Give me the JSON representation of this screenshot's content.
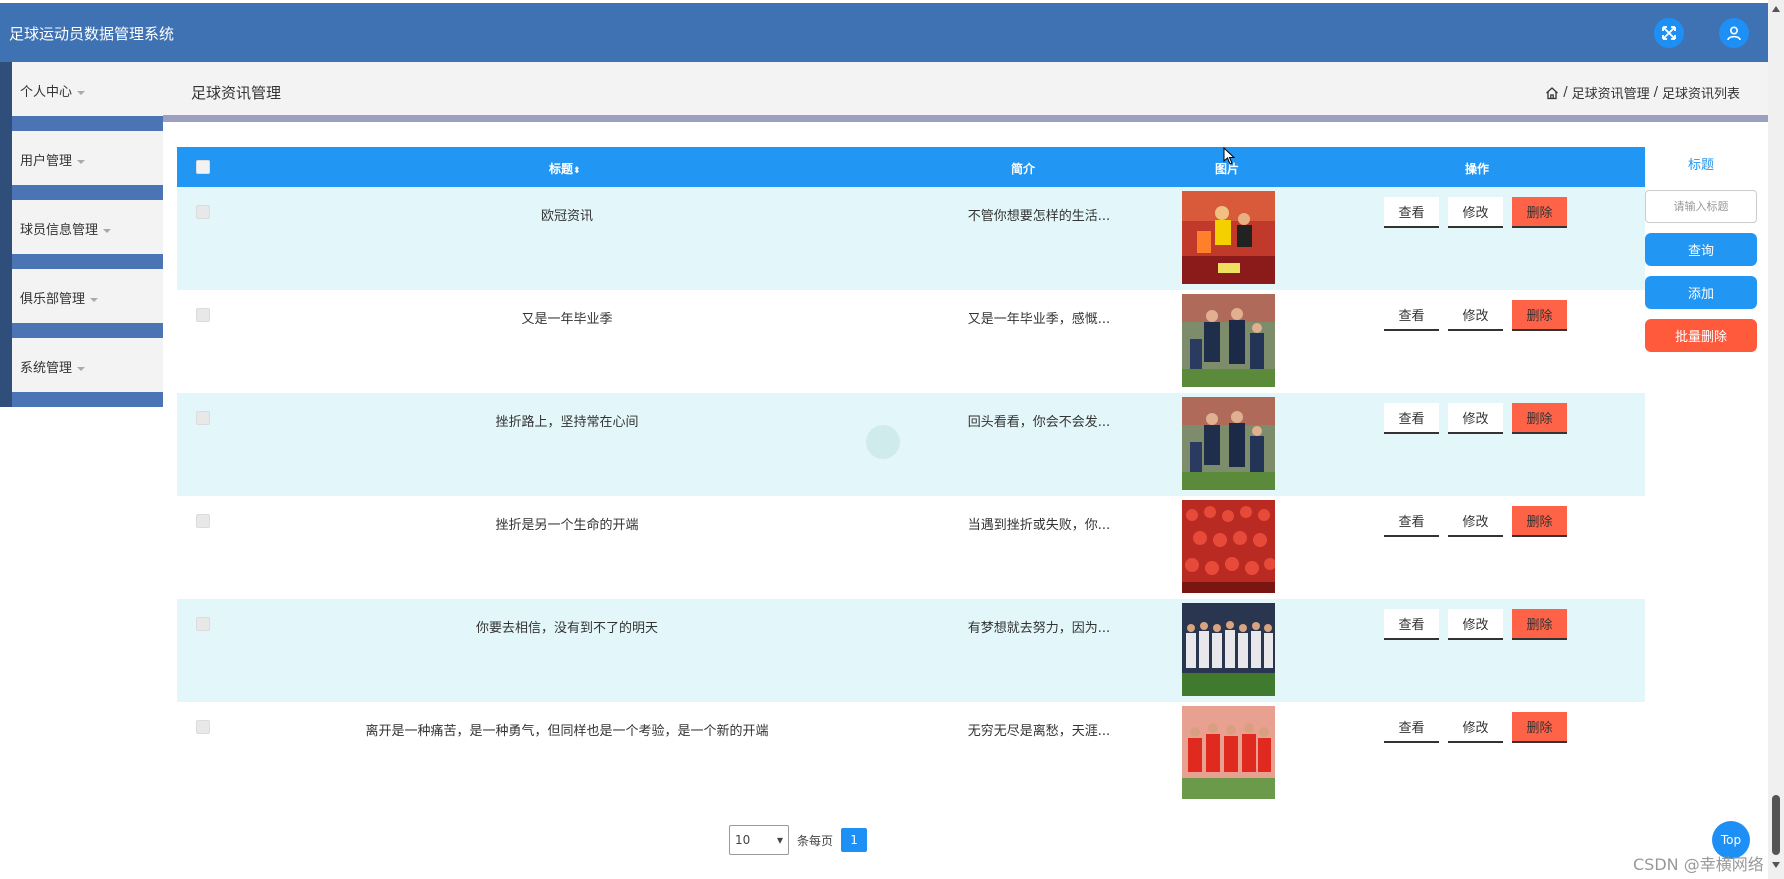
{
  "app": {
    "title": "足球运动员数据管理系统"
  },
  "topbar": {
    "fullscreen_icon": "fullscreen-icon",
    "user_icon": "user-icon"
  },
  "sidebar": {
    "items": [
      {
        "label": "个人中心"
      },
      {
        "label": "用户管理"
      },
      {
        "label": "球员信息管理"
      },
      {
        "label": "俱乐部管理"
      },
      {
        "label": "系统管理"
      }
    ]
  },
  "header": {
    "page_title": "足球资讯管理",
    "breadcrumb": [
      "足球资讯管理",
      "足球资讯列表"
    ],
    "breadcrumb_sep": "/"
  },
  "table": {
    "columns": {
      "title": "标题",
      "summary": "简介",
      "image": "图片",
      "actions": "操作"
    },
    "rows": [
      {
        "title": "欧冠资讯",
        "summary": "不管你想要怎样的生活...",
        "image": "photo-players-match"
      },
      {
        "title": "又是一年毕业季",
        "summary": "又是一年毕业季，感慨...",
        "image": "photo-players-celebrate"
      },
      {
        "title": "挫折路上，坚持常在心间",
        "summary": "回头看看，你会不会发...",
        "image": "photo-players-celebrate"
      },
      {
        "title": "挫折是另一个生命的开端",
        "summary": "当遇到挫折或失败，你...",
        "image": "photo-crowd-red"
      },
      {
        "title": "你要去相信，没有到不了的明天",
        "summary": "有梦想就去努力，因为...",
        "image": "photo-team-lineup"
      },
      {
        "title": "离开是一种痛苦，是一种勇气，但同样也是一个考验，是一个新的开端",
        "summary": "无穷无尽是离愁，天涯...",
        "image": "photo-team-red"
      }
    ],
    "buttons": {
      "view": "查看",
      "edit": "修改",
      "delete": "删除"
    }
  },
  "search_panel": {
    "label": "标题",
    "placeholder": "请输入标题",
    "query": "查询",
    "add": "添加",
    "batch_delete": "批量删除"
  },
  "pagination": {
    "page_size": "10",
    "per_page_label": "条每页",
    "current_page": "1"
  },
  "fab": {
    "top": "Top"
  },
  "watermark": "CSDN @幸横网络",
  "colors": {
    "topbar": "#3f72b3",
    "table_header": "#2196f3",
    "row_alt": "#e3f7fa",
    "delete": "#ff6347"
  }
}
